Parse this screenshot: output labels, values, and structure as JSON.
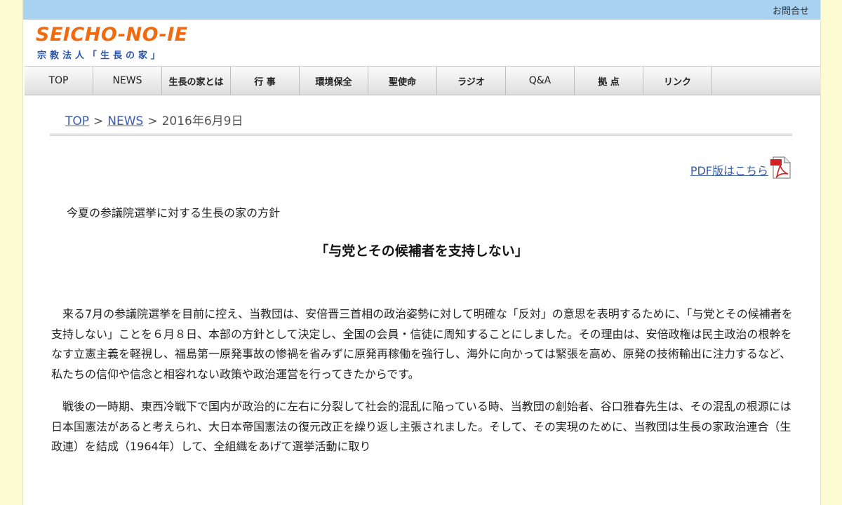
{
  "topbar": {
    "contact_label": "お問合せ"
  },
  "logo": {
    "main": "SEICHO-NO-IE",
    "sub": "宗教法人「生長の家」"
  },
  "nav": {
    "items": [
      "TOP",
      "NEWS",
      "生長の家とは",
      "行 事",
      "環境保全",
      "聖使命",
      "ラジオ",
      "Q&A",
      "拠 点",
      "リンク"
    ]
  },
  "breadcrumb": {
    "top": "TOP",
    "news": "NEWS",
    "current": "2016年6月9日",
    "sep": ">"
  },
  "pdf": {
    "label": "PDF版はこちら",
    "icon": "pdf-icon"
  },
  "article": {
    "subtitle": "今夏の参議院選挙に対する生長の家の方針",
    "headline": "「与党とその候補者を支持しない」",
    "paragraphs": [
      "来る7月の参議院選挙を目前に控え、当教団は、安倍晋三首相の政治姿勢に対して明確な「反対」の意思を表明するために、「与党とその候補者を支持しない」ことを６月８日、本部の方針として決定し、全国の会員・信徒に周知することにしました。その理由は、安倍政権は民主政治の根幹をなす立憲主義を軽視し、福島第一原発事故の惨禍を省みずに原発再稼働を強行し、海外に向かっては緊張を高め、原発の技術輸出に注力するなど、私たちの信仰や信念と相容れない政策や政治運営を行ってきたからです。",
      "戦後の一時期、東西冷戦下で国内が政治的に左右に分裂して社会的混乱に陥っている時、当教団の創始者、谷口雅春先生は、その混乱の根源には日本国憲法があると考えられ、大日本帝国憲法の復元改正を繰り返し主張されました。そして、その実現のために、当教団は生長の家政治連合（生政連）を結成（1964年）して、全組織をあげて選挙活動に取り"
    ]
  },
  "colors": {
    "page_bg": "#fdfbd2",
    "topbar": "#a9d2f1",
    "logo_orange": "#f26a10",
    "logo_blue": "#2a55a8",
    "link": "#3b5ea8"
  }
}
